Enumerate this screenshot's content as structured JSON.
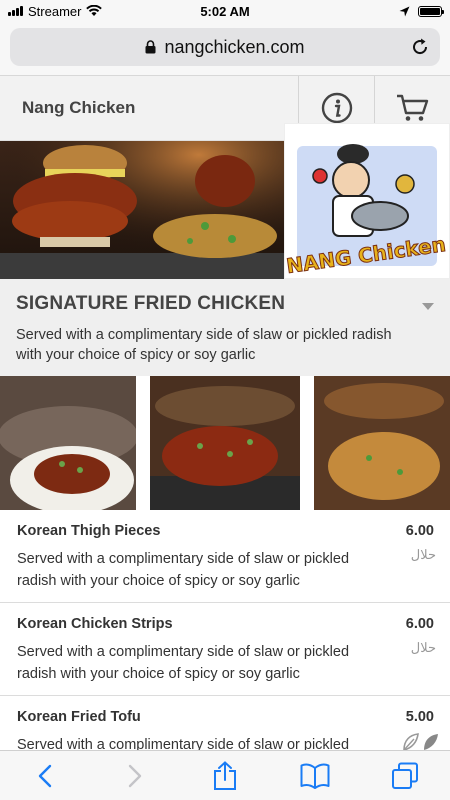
{
  "status_bar": {
    "carrier": "Streamer",
    "time": "5:02 AM",
    "battery_level": 1.0,
    "icons": [
      "signal-icon",
      "wifi-icon",
      "location-icon",
      "battery-icon"
    ]
  },
  "browser": {
    "url": "nangchicken.com",
    "icons": [
      "lock-icon",
      "reload-icon"
    ]
  },
  "header": {
    "title": "Nang Chicken",
    "icons": [
      "info-icon",
      "cart-icon"
    ]
  },
  "hero": {
    "logo_text": "NANG Chicken"
  },
  "section": {
    "title": "SIGNATURE FRIED CHICKEN",
    "description": "Served with a complimentary side of slaw or pickled radish with your choice of spicy or soy garlic"
  },
  "menu_items": [
    {
      "name": "Korean Thigh Pieces",
      "price": "6.00",
      "description": "Served with a complimentary side of slaw or pickled radish with your choice of spicy or soy garlic",
      "badge": "حلال"
    },
    {
      "name": "Korean Chicken Strips",
      "price": "6.00",
      "description": "Served with a complimentary side of slaw or pickled radish with your choice of spicy or soy garlic",
      "badge": "حلال"
    },
    {
      "name": "Korean Fried Tofu",
      "price": "5.00",
      "description": "Served with a complimentary side of slaw or pickled radish with your choice of spicy or soy garlic",
      "badge": ""
    }
  ],
  "toolbar": {
    "icons": [
      "back-icon",
      "forward-icon",
      "share-icon",
      "bookmarks-icon",
      "tabs-icon"
    ]
  },
  "colors": {
    "accent_ios": "#1a7cf5",
    "header_bg": "#f2f2f2",
    "text": "#333333"
  }
}
